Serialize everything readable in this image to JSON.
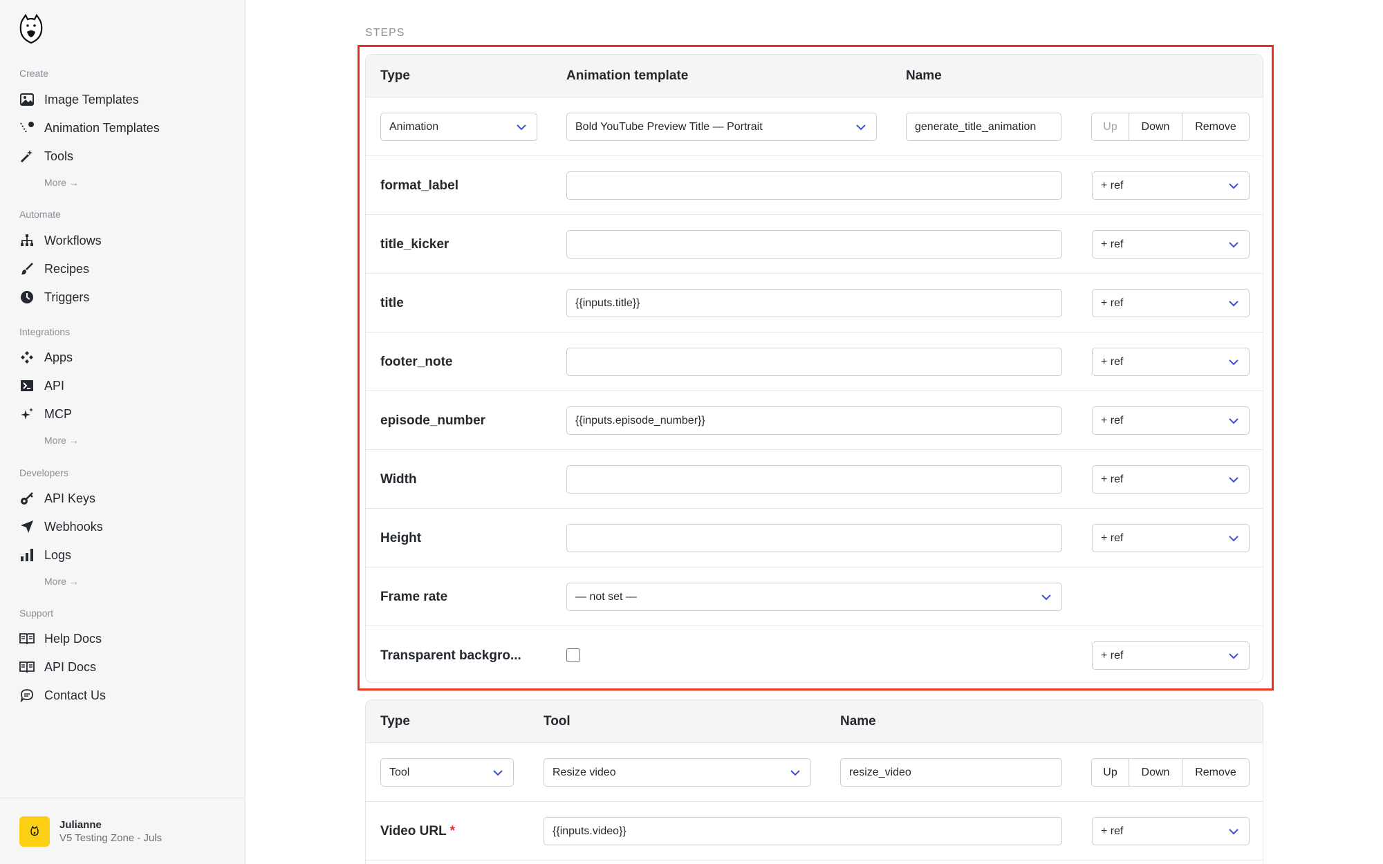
{
  "sidebar": {
    "sections": [
      {
        "title": "Create",
        "items": [
          {
            "label": "Image Templates",
            "icon": "image-icon"
          },
          {
            "label": "Animation Templates",
            "icon": "animation-icon"
          },
          {
            "label": "Tools",
            "icon": "magic-wand-icon"
          }
        ],
        "more": "More →"
      },
      {
        "title": "Automate",
        "items": [
          {
            "label": "Workflows",
            "icon": "workflow-icon"
          },
          {
            "label": "Recipes",
            "icon": "brush-icon"
          },
          {
            "label": "Triggers",
            "icon": "clock-icon"
          }
        ]
      },
      {
        "title": "Integrations",
        "items": [
          {
            "label": "Apps",
            "icon": "apps-icon"
          },
          {
            "label": "API",
            "icon": "terminal-icon"
          },
          {
            "label": "MCP",
            "icon": "sparkle-icon"
          }
        ],
        "more": "More →"
      },
      {
        "title": "Developers",
        "items": [
          {
            "label": "API Keys",
            "icon": "key-icon"
          },
          {
            "label": "Webhooks",
            "icon": "send-icon"
          },
          {
            "label": "Logs",
            "icon": "bar-chart-icon"
          }
        ],
        "more": "More →"
      },
      {
        "title": "Support",
        "items": [
          {
            "label": "Help Docs",
            "icon": "book-icon"
          },
          {
            "label": "API Docs",
            "icon": "book-icon"
          },
          {
            "label": "Contact Us",
            "icon": "chat-icon"
          }
        ]
      }
    ],
    "user": {
      "name": "Julianne",
      "workspace": "V5 Testing Zone - Juls"
    }
  },
  "main": {
    "steps_label": "STEPS",
    "step1": {
      "headers": {
        "type": "Type",
        "template": "Animation template",
        "name": "Name"
      },
      "type_value": "Animation",
      "template_value": "Bold YouTube Preview Title — Portrait",
      "name_value": "generate_title_animation",
      "buttons": {
        "up": "Up",
        "down": "Down",
        "remove": "Remove"
      },
      "fields": [
        {
          "label": "format_label",
          "value": "",
          "ref": "+ ref"
        },
        {
          "label": "title_kicker",
          "value": "",
          "ref": "+ ref"
        },
        {
          "label": "title",
          "value": "{{inputs.title}}",
          "ref": "+ ref"
        },
        {
          "label": "footer_note",
          "value": "",
          "ref": "+ ref"
        },
        {
          "label": "episode_number",
          "value": "{{inputs.episode_number}}",
          "ref": "+ ref"
        },
        {
          "label": "Width",
          "value": "",
          "ref": "+ ref"
        },
        {
          "label": "Height",
          "value": "",
          "ref": "+ ref"
        }
      ],
      "frame_rate": {
        "label": "Frame rate",
        "value": "— not set —"
      },
      "transparent": {
        "label": "Transparent backgro...",
        "checked": false,
        "ref": "+ ref"
      }
    },
    "step2": {
      "headers": {
        "type": "Type",
        "tool": "Tool",
        "name": "Name"
      },
      "type_value": "Tool",
      "tool_value": "Resize video",
      "name_value": "resize_video",
      "buttons": {
        "up": "Up",
        "down": "Down",
        "remove": "Remove"
      },
      "fields": [
        {
          "label": "Video URL",
          "required": "*",
          "value": "{{inputs.video}}",
          "ref": "+ ref"
        }
      ]
    }
  },
  "colors": {
    "accent_chevron": "#3b4fd6",
    "highlight": "#e8321f",
    "avatar": "#fcd015"
  }
}
